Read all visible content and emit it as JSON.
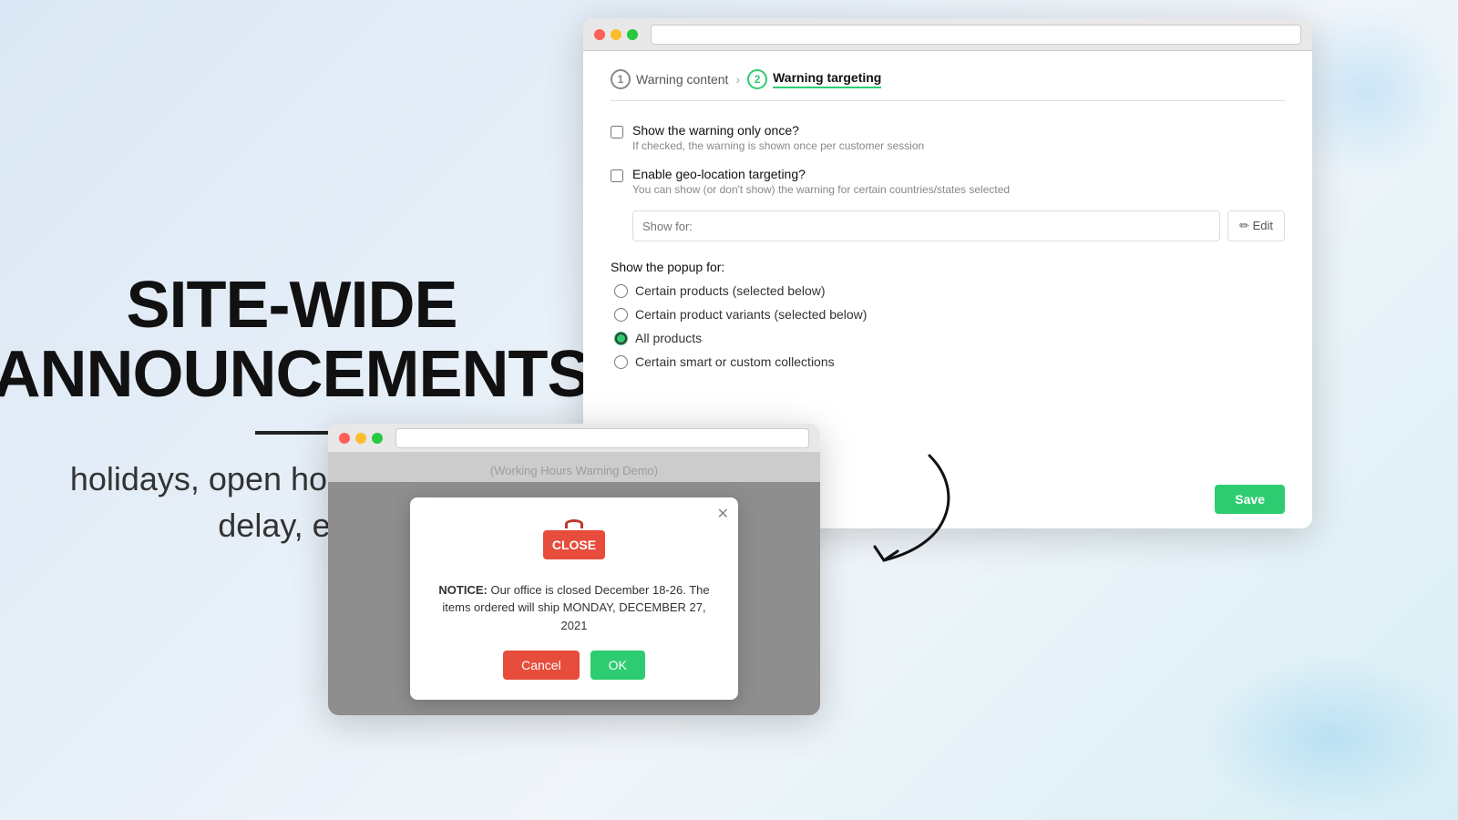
{
  "left": {
    "title_line1": "SITE-WIDE",
    "title_line2": "ANNOUNCEMENTS",
    "subtitle": "holidays, open hours, shipping delay, etc."
  },
  "browser_main": {
    "url_placeholder": "",
    "steps": [
      {
        "number": "1",
        "label": "Warning content",
        "active": false
      },
      {
        "number": "2",
        "label": "Warning targeting",
        "active": true
      }
    ],
    "show_once_label": "Show the warning only once?",
    "show_once_sub": "If checked, the warning is shown once per customer session",
    "geo_label": "Enable geo-location targeting?",
    "geo_sub": "You can show (or don't show) the warning for certain countries/states selected",
    "show_for_placeholder": "Show for:",
    "edit_btn_label": "✏ Edit",
    "popup_section_label": "Show the popup for:",
    "radio_options": [
      "Certain products (selected below)",
      "Certain product variants (selected below)",
      "All products",
      "Certain smart or custom collections"
    ],
    "radio_selected_index": 2,
    "save_btn": "Save"
  },
  "browser_popup": {
    "page_title": "(Working Hours Warning Demo)",
    "modal": {
      "close_sign_text": "CLOSE",
      "notice_prefix": "NOTICE:",
      "notice_text": "Our office is closed December 18-26. The items ordered will ship MONDAY, DECEMBER 27, 2021",
      "cancel_btn": "Cancel",
      "ok_btn": "OK"
    }
  }
}
